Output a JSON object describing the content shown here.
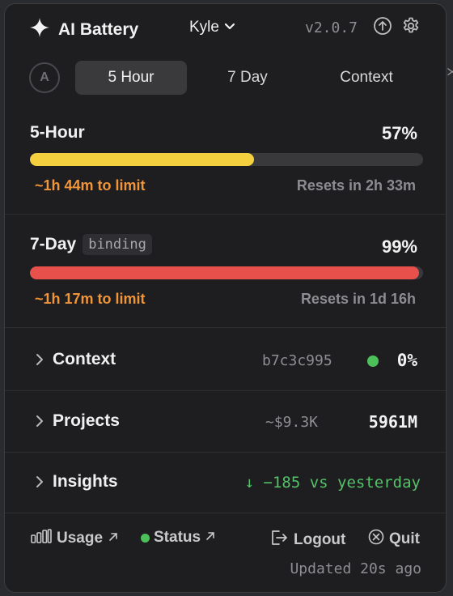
{
  "header": {
    "app_name": "AI Battery",
    "user": "Kyle",
    "version": "v2.0.7"
  },
  "avatar_letter": "A",
  "tabs": [
    {
      "label": "5 Hour",
      "active": true
    },
    {
      "label": "7 Day",
      "active": false
    },
    {
      "label": "Context",
      "active": false
    }
  ],
  "usage": [
    {
      "title": "5-Hour",
      "badge": "",
      "percent_label": "57%",
      "fill_percent": 57,
      "color": "#f4d03f",
      "limit": "~1h 44m to limit",
      "reset": "Resets in 2h 33m"
    },
    {
      "title": "7-Day",
      "badge": "binding",
      "percent_label": "99%",
      "fill_percent": 99,
      "color": "#e8504c",
      "limit": "~1h 17m to limit",
      "reset": "Resets in 1d 16h"
    }
  ],
  "rows": {
    "context": {
      "label": "Context",
      "meta": "b7c3c995",
      "value": "0%"
    },
    "projects": {
      "label": "Projects",
      "meta": "~$9.3K",
      "value": "5961M"
    },
    "insights": {
      "label": "Insights",
      "value": "↓ −185 vs yesterday"
    }
  },
  "footer": {
    "usage": "Usage",
    "status": "Status",
    "logout": "Logout",
    "quit": "Quit",
    "updated": "Updated 20s ago"
  },
  "colors": {
    "accent_yellow": "#f4d03f",
    "accent_red": "#e8504c",
    "warning_orange": "#f0953a",
    "status_green": "#4cc159"
  }
}
